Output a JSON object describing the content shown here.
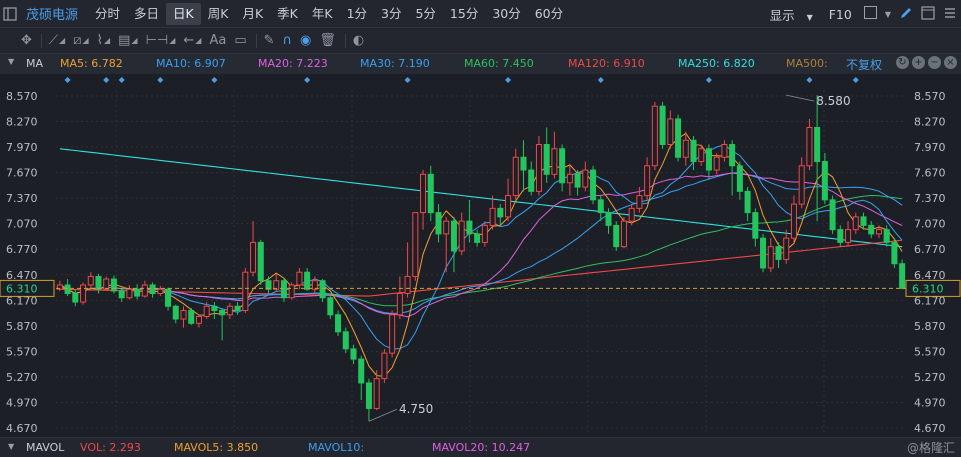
{
  "toolbar": {
    "stock_name": "茂硕电源",
    "periods": [
      "分时",
      "多日",
      "日K",
      "周K",
      "月K",
      "季K",
      "年K",
      "1分",
      "3分",
      "5分",
      "15分",
      "30分",
      "60分"
    ],
    "active_period": "日K",
    "display_label": "显示",
    "f10_label": "F10"
  },
  "drawing_tools": {
    "text_tool_label": "Aa"
  },
  "ma_bar": {
    "label": "MA",
    "items": [
      {
        "text": "MA5: 6.782",
        "color": "#f0a030"
      },
      {
        "text": "MA10: 6.907",
        "color": "#3aa0f0"
      },
      {
        "text": "MA20: 7.223",
        "color": "#e060e0"
      },
      {
        "text": "MA30: 7.190",
        "color": "#3aa0f0"
      },
      {
        "text": "MA60: 7.450",
        "color": "#30c060"
      },
      {
        "text": "MA120: 6.910",
        "color": "#f04848"
      },
      {
        "text": "MA250: 6.820",
        "color": "#30e0e0"
      },
      {
        "text": "MA500:",
        "color": "#b08040"
      }
    ],
    "fuquan_label": "不复权"
  },
  "vol_bar": {
    "label": "MAVOL",
    "items": [
      {
        "text": "VOL: 2.293",
        "color": "#f04848"
      },
      {
        "text": "MAVOL5: 3.850",
        "color": "#f0a030"
      },
      {
        "text": "MAVOL10:",
        "color": "#3aa0f0"
      },
      {
        "text": "MAVOL20: 10.247",
        "color": "#e060e0"
      }
    ],
    "watermark": "@格隆汇"
  },
  "colors": {
    "up": "#f04848",
    "down": "#22c55e",
    "ma5": "#f0a030",
    "ma10": "#3aa0f0",
    "ma20": "#e060e0",
    "ma30": "#3aa0f0",
    "ma60": "#30c060",
    "ma120": "#f04848",
    "ma250": "#30e0e0",
    "current_price": "#d4a030",
    "diamond": "#4a9fe8"
  },
  "chart_data": {
    "type": "candlestick",
    "y_ticks": [
      8.57,
      8.27,
      7.97,
      7.67,
      7.37,
      7.07,
      6.77,
      6.47,
      6.17,
      5.87,
      5.57,
      5.27,
      4.97,
      4.67
    ],
    "ylim": [
      4.6,
      8.64
    ],
    "current_price": 6.31,
    "current_price_label": "6.310",
    "annotations": [
      {
        "text": "8.580",
        "value": 8.58,
        "index": 94
      },
      {
        "text": "4.750",
        "value": 4.75,
        "index": 40
      }
    ],
    "candles": [
      [
        6.3,
        6.35,
        6.28,
        6.4
      ],
      [
        6.35,
        6.25,
        6.22,
        6.42
      ],
      [
        6.25,
        6.15,
        6.1,
        6.3
      ],
      [
        6.15,
        6.35,
        6.12,
        6.38
      ],
      [
        6.35,
        6.45,
        6.3,
        6.5
      ],
      [
        6.45,
        6.3,
        6.25,
        6.48
      ],
      [
        6.3,
        6.42,
        6.28,
        6.45
      ],
      [
        6.42,
        6.28,
        6.25,
        6.46
      ],
      [
        6.28,
        6.2,
        6.15,
        6.32
      ],
      [
        6.2,
        6.3,
        6.18,
        6.35
      ],
      [
        6.3,
        6.22,
        6.18,
        6.36
      ],
      [
        6.22,
        6.35,
        6.2,
        6.4
      ],
      [
        6.35,
        6.25,
        6.2,
        6.38
      ],
      [
        6.25,
        6.3,
        6.22,
        6.34
      ],
      [
        6.3,
        6.1,
        6.05,
        6.32
      ],
      [
        6.1,
        5.95,
        5.9,
        6.12
      ],
      [
        5.95,
        6.05,
        5.85,
        6.1
      ],
      [
        6.05,
        5.9,
        5.88,
        6.08
      ],
      [
        5.9,
        5.98,
        5.85,
        6.0
      ],
      [
        5.98,
        6.1,
        5.95,
        6.15
      ],
      [
        6.1,
        6.05,
        5.95,
        6.15
      ],
      [
        6.05,
        6.0,
        5.7,
        6.08
      ],
      [
        6.0,
        6.1,
        5.95,
        6.14
      ],
      [
        6.1,
        6.05,
        6.0,
        6.15
      ],
      [
        6.05,
        6.5,
        6.02,
        6.55
      ],
      [
        6.5,
        6.85,
        6.45,
        7.1
      ],
      [
        6.85,
        6.4,
        6.35,
        6.88
      ],
      [
        6.4,
        6.3,
        6.25,
        6.45
      ],
      [
        6.3,
        6.4,
        6.28,
        6.48
      ],
      [
        6.4,
        6.2,
        6.15,
        6.43
      ],
      [
        6.2,
        6.35,
        6.18,
        6.38
      ],
      [
        6.35,
        6.5,
        6.3,
        6.55
      ],
      [
        6.5,
        6.3,
        6.28,
        6.55
      ],
      [
        6.3,
        6.4,
        6.25,
        6.45
      ],
      [
        6.4,
        6.2,
        6.15,
        6.42
      ],
      [
        6.2,
        6.0,
        5.95,
        6.25
      ],
      [
        6.0,
        5.8,
        5.75,
        6.05
      ],
      [
        5.8,
        5.6,
        5.55,
        5.85
      ],
      [
        5.6,
        5.48,
        5.42,
        5.65
      ],
      [
        5.48,
        5.2,
        5.0,
        5.52
      ],
      [
        5.2,
        4.9,
        4.75,
        5.25
      ],
      [
        4.9,
        5.25,
        4.88,
        5.35
      ],
      [
        5.25,
        5.55,
        5.2,
        5.6
      ],
      [
        5.55,
        6.0,
        5.5,
        6.05
      ],
      [
        6.0,
        6.25,
        5.95,
        6.45
      ],
      [
        6.25,
        6.45,
        6.2,
        6.85
      ],
      [
        6.45,
        7.2,
        6.4,
        7.2
      ],
      [
        7.2,
        7.65,
        7.0,
        7.7
      ],
      [
        7.65,
        7.2,
        7.1,
        7.75
      ],
      [
        7.2,
        6.95,
        6.85,
        7.3
      ],
      [
        6.95,
        7.1,
        6.5,
        7.15
      ],
      [
        7.1,
        6.75,
        6.5,
        7.15
      ],
      [
        6.75,
        7.1,
        6.7,
        7.2
      ],
      [
        7.1,
        6.95,
        6.85,
        7.35
      ],
      [
        6.95,
        6.85,
        6.8,
        7.0
      ],
      [
        6.85,
        7.05,
        6.8,
        7.1
      ],
      [
        7.05,
        7.25,
        7.0,
        7.4
      ],
      [
        7.25,
        7.15,
        7.05,
        7.3
      ],
      [
        7.15,
        7.4,
        7.1,
        7.6
      ],
      [
        7.4,
        7.85,
        7.35,
        7.95
      ],
      [
        7.85,
        7.7,
        7.45,
        8.05
      ],
      [
        7.7,
        7.45,
        7.4,
        7.8
      ],
      [
        7.45,
        8.0,
        7.4,
        8.1
      ],
      [
        8.0,
        7.65,
        7.55,
        8.2
      ],
      [
        7.65,
        7.95,
        7.6,
        8.15
      ],
      [
        7.95,
        7.55,
        7.45,
        8.0
      ],
      [
        7.55,
        7.65,
        7.4,
        7.75
      ],
      [
        7.65,
        7.5,
        7.4,
        7.7
      ],
      [
        7.5,
        7.7,
        7.45,
        7.8
      ],
      [
        7.7,
        7.35,
        7.3,
        7.75
      ],
      [
        7.35,
        7.2,
        7.1,
        7.4
      ],
      [
        7.2,
        7.05,
        6.95,
        7.25
      ],
      [
        7.05,
        6.8,
        6.75,
        7.1
      ],
      [
        6.8,
        7.1,
        6.78,
        7.15
      ],
      [
        7.1,
        7.25,
        7.05,
        7.3
      ],
      [
        7.25,
        7.4,
        7.2,
        7.5
      ],
      [
        7.4,
        7.75,
        7.35,
        7.85
      ],
      [
        7.75,
        8.45,
        7.7,
        8.5
      ],
      [
        8.45,
        8.0,
        7.95,
        8.5
      ],
      [
        8.0,
        8.3,
        7.95,
        8.4
      ],
      [
        8.3,
        7.85,
        7.8,
        8.35
      ],
      [
        7.85,
        8.05,
        7.75,
        8.15
      ],
      [
        8.05,
        7.8,
        7.7,
        8.1
      ],
      [
        7.8,
        7.95,
        7.75,
        8.0
      ],
      [
        7.95,
        7.7,
        7.6,
        8.0
      ],
      [
        7.7,
        7.85,
        7.65,
        7.9
      ],
      [
        7.85,
        8.0,
        7.8,
        8.05
      ],
      [
        8.0,
        7.75,
        7.4,
        8.05
      ],
      [
        7.75,
        7.45,
        7.35,
        7.8
      ],
      [
        7.45,
        7.2,
        7.1,
        7.5
      ],
      [
        7.2,
        6.9,
        6.8,
        7.25
      ],
      [
        6.9,
        6.55,
        6.5,
        6.95
      ],
      [
        6.55,
        6.8,
        6.5,
        6.9
      ],
      [
        6.8,
        6.65,
        6.55,
        6.85
      ],
      [
        6.65,
        6.9,
        6.6,
        7.0
      ],
      [
        6.9,
        7.3,
        6.85,
        7.4
      ],
      [
        7.3,
        7.75,
        7.25,
        7.85
      ],
      [
        7.75,
        8.2,
        7.7,
        8.3
      ],
      [
        8.2,
        7.8,
        7.1,
        8.58
      ],
      [
        7.8,
        7.35,
        7.3,
        7.9
      ],
      [
        7.35,
        7.0,
        6.95,
        7.4
      ],
      [
        7.0,
        6.85,
        6.8,
        7.05
      ],
      [
        6.85,
        7.0,
        6.8,
        7.1
      ],
      [
        7.0,
        7.15,
        6.95,
        7.2
      ],
      [
        7.15,
        7.05,
        7.0,
        7.2
      ],
      [
        7.05,
        6.95,
        6.9,
        7.1
      ],
      [
        6.95,
        7.0,
        6.9,
        7.05
      ],
      [
        7.0,
        6.85,
        6.8,
        7.05
      ],
      [
        6.85,
        6.6,
        6.55,
        6.9
      ],
      [
        6.6,
        6.31,
        6.3,
        6.65
      ]
    ]
  }
}
